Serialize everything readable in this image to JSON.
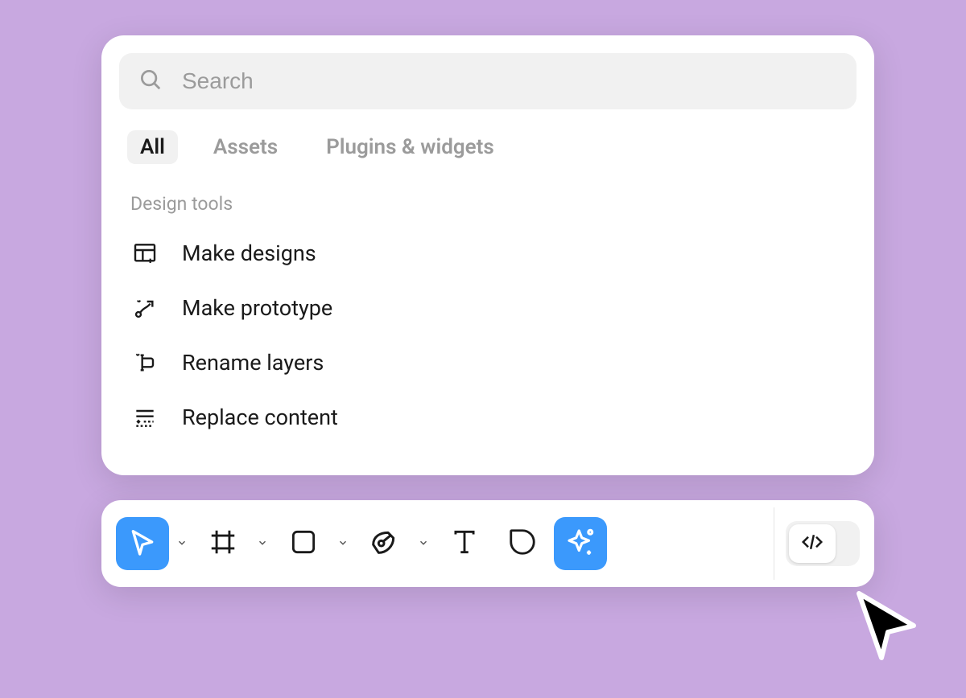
{
  "search": {
    "placeholder": "Search"
  },
  "tabs": [
    {
      "label": "All",
      "active": true
    },
    {
      "label": "Assets",
      "active": false
    },
    {
      "label": "Plugins & widgets",
      "active": false
    }
  ],
  "section_header": "Design tools",
  "tools": [
    {
      "label": "Make designs",
      "icon": "make-designs-icon"
    },
    {
      "label": "Make prototype",
      "icon": "make-prototype-icon"
    },
    {
      "label": "Rename layers",
      "icon": "rename-layers-icon"
    },
    {
      "label": "Replace content",
      "icon": "replace-content-icon"
    }
  ],
  "toolbar": {
    "select": {
      "icon": "cursor-icon",
      "active": true,
      "has_menu": true
    },
    "frame": {
      "icon": "frame-icon",
      "active": false,
      "has_menu": true
    },
    "shape": {
      "icon": "rectangle-icon",
      "active": false,
      "has_menu": true
    },
    "pen": {
      "icon": "pen-icon",
      "active": false,
      "has_menu": true
    },
    "text": {
      "icon": "text-icon",
      "active": false,
      "has_menu": false
    },
    "comment": {
      "icon": "comment-icon",
      "active": false,
      "has_menu": false
    },
    "ai": {
      "icon": "ai-sparkle-icon",
      "active": true,
      "has_menu": false
    },
    "dev_mode": {
      "icon": "code-icon",
      "enabled": false
    }
  },
  "colors": {
    "accent": "#3b99fc",
    "background": "#c8a8e0"
  }
}
